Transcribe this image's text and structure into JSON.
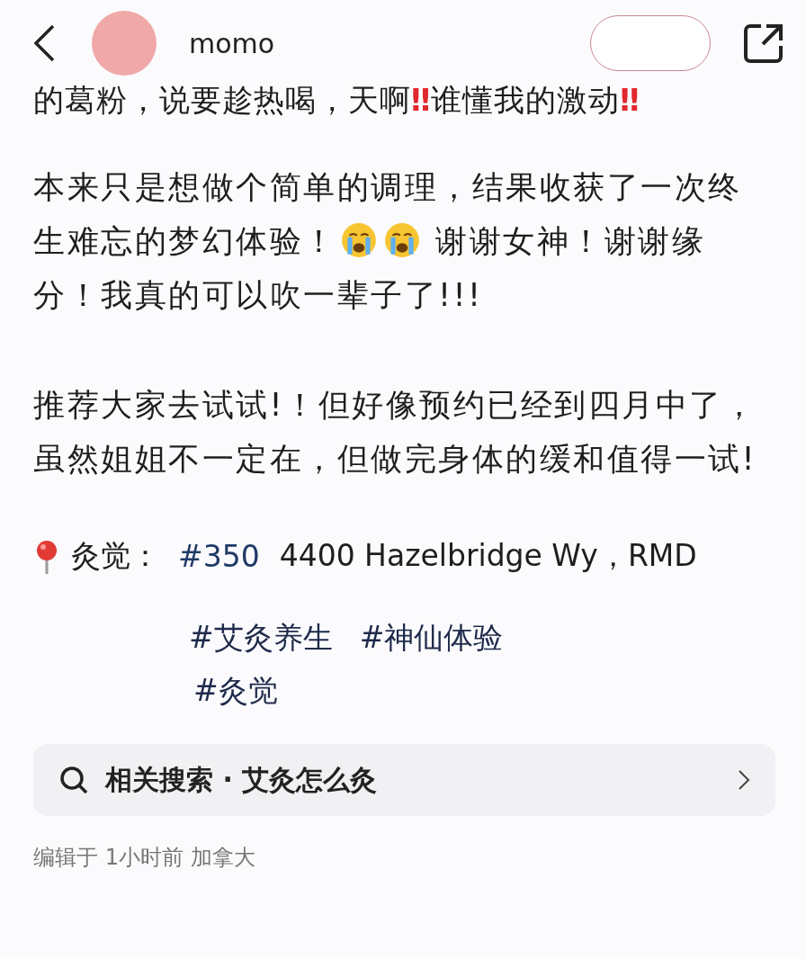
{
  "header": {
    "username": "momo",
    "follow_button": {
      "kind": "empty"
    }
  },
  "cut_line": [
    {
      "kind": "text",
      "text": "的葛粉，说要趁热喝，天啊"
    },
    {
      "kind": "mark",
      "text": "‼"
    },
    {
      "kind": "text",
      "text": "谁懂我的激动"
    },
    {
      "kind": "mark",
      "text": "‼"
    }
  ],
  "paragraphs": [
    {
      "segments": [
        {
          "kind": "text",
          "text": "本来只是想做个简单的调理，结果收获了一次终生难忘的梦幻体验！"
        },
        {
          "kind": "cry"
        },
        {
          "kind": "cry"
        },
        {
          "kind": "text",
          "text": " 谢谢女神！谢谢缘分！我真的可以吹一辈子了!!!"
        }
      ]
    },
    {
      "segments": [
        {
          "kind": "text",
          "text": "推荐大家去试试!！但好像预约已经到四月中了，虽然姐姐不一定在，但做完身体的缓和值得一试!"
        }
      ]
    }
  ],
  "location": {
    "name": "灸觉：",
    "tag": "#350",
    "address": "4400 Hazelbridge Wy，RMD"
  },
  "hashtag_rows": [
    [
      "#艾灸养生",
      "#神仙体验"
    ],
    [
      "#灸觉"
    ]
  ],
  "related_search": {
    "label": "相关搜索 · 艾灸怎么灸"
  },
  "footer": "编辑于 1小时前 加拿大"
}
